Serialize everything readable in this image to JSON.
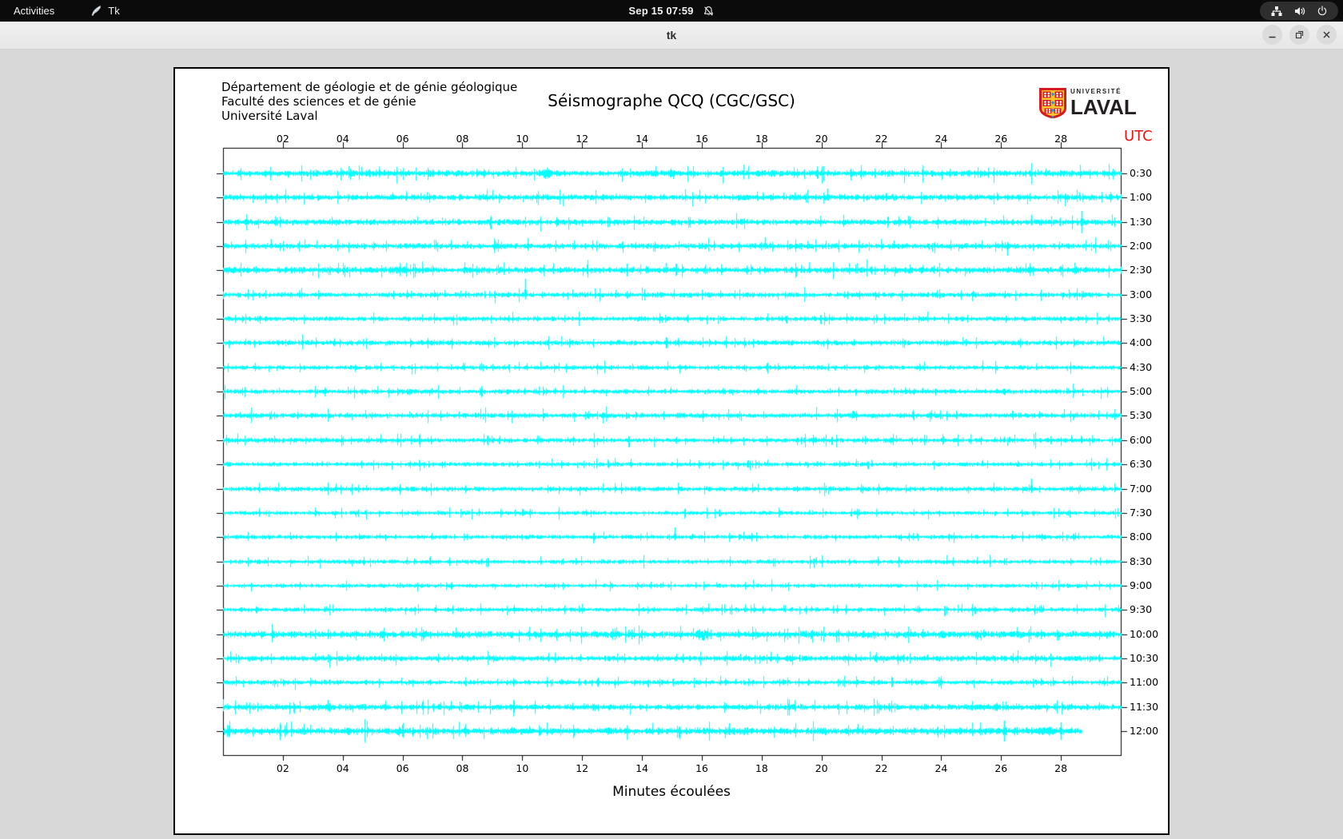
{
  "top_bar": {
    "activities_label": "Activities",
    "app_indicator": "Tk",
    "clock": "Sep 15 07:59"
  },
  "window": {
    "title": "tk"
  },
  "figure": {
    "institution_lines": [
      "Département de géologie et de génie géologique",
      "Faculté des sciences et de génie",
      "Université Laval"
    ],
    "title": "Séismographe QCQ (CGC/GSC)",
    "logo_small": "UNIVERSITÉ",
    "logo_large": "LAVAL",
    "utc_label": "UTC",
    "xlabel": "Minutes écoulées",
    "colors": {
      "trace": "#00ffff",
      "utc_label": "#ee1111",
      "axis": "#000000",
      "logo_red": "#d71920",
      "logo_gold": "#ffc72c",
      "logo_blue": "#1e9cd7"
    }
  },
  "chart_data": {
    "type": "line",
    "title": "Séismographe QCQ (CGC/GSC)",
    "xlabel": "Minutes écoulées",
    "right_axis_title": "UTC",
    "x_range_minutes": [
      0,
      30
    ],
    "x_ticks": [
      "02",
      "04",
      "06",
      "08",
      "10",
      "12",
      "14",
      "16",
      "18",
      "20",
      "22",
      "24",
      "26",
      "28"
    ],
    "x_tick_minutes": [
      2,
      4,
      6,
      8,
      10,
      12,
      14,
      16,
      18,
      20,
      22,
      24,
      26,
      28
    ],
    "trace_color": "#00ffff",
    "rows": [
      {
        "label": "0:30",
        "noise": 1.8,
        "end_minute": 30,
        "events": [
          {
            "type": "burst",
            "m": 10.8,
            "len": 0.5,
            "amp": 7
          },
          {
            "type": "burst",
            "m": 17.9,
            "len": 0.4,
            "amp": 4
          }
        ]
      },
      {
        "label": "1:00",
        "noise": 1.6,
        "end_minute": 30,
        "events": [
          {
            "type": "spike",
            "m": 20.2,
            "up": 11,
            "down": 4
          }
        ]
      },
      {
        "label": "1:30",
        "noise": 1.6,
        "end_minute": 30,
        "events": [
          {
            "type": "spike",
            "m": 22.9,
            "up": 8,
            "down": 3
          },
          {
            "type": "spike",
            "m": 27.0,
            "up": 9,
            "down": 4
          },
          {
            "type": "spike",
            "m": 28.7,
            "up": 14,
            "down": 14
          }
        ]
      },
      {
        "label": "2:00",
        "noise": 1.5,
        "end_minute": 30,
        "events": [
          {
            "type": "spike",
            "m": 1.6,
            "up": 9,
            "down": 3
          },
          {
            "type": "spike",
            "m": 18.1,
            "up": 11,
            "down": 4
          },
          {
            "type": "spike",
            "m": 22.4,
            "up": 7,
            "down": 3
          },
          {
            "type": "spike",
            "m": 26.2,
            "up": 5,
            "down": 12
          }
        ]
      },
      {
        "label": "2:30",
        "noise": 1.7,
        "end_minute": 30,
        "events": [
          {
            "type": "burst",
            "m": 0.2,
            "len": 0.4,
            "amp": 5
          },
          {
            "type": "burst",
            "m": 5.9,
            "len": 0.8,
            "amp": 5
          },
          {
            "type": "spike",
            "m": 13.5,
            "up": 8,
            "down": 8
          },
          {
            "type": "spike",
            "m": 14.8,
            "up": 9,
            "down": 4
          }
        ]
      },
      {
        "label": "3:00",
        "noise": 1.4,
        "end_minute": 30,
        "events": [
          {
            "type": "spike",
            "m": 10.1,
            "up": 20,
            "down": 6
          }
        ]
      },
      {
        "label": "3:30",
        "noise": 1.3,
        "end_minute": 30,
        "events": []
      },
      {
        "label": "4:00",
        "noise": 1.4,
        "end_minute": 30,
        "events": [
          {
            "type": "spike",
            "m": 14.8,
            "up": 7,
            "down": 7
          },
          {
            "type": "spike",
            "m": 15.2,
            "up": 6,
            "down": 3
          }
        ]
      },
      {
        "label": "4:30",
        "noise": 1.2,
        "end_minute": 30,
        "events": []
      },
      {
        "label": "5:00",
        "noise": 1.3,
        "end_minute": 30,
        "events": []
      },
      {
        "label": "5:30",
        "noise": 1.4,
        "end_minute": 30,
        "events": []
      },
      {
        "label": "6:00",
        "noise": 1.3,
        "end_minute": 30,
        "events": []
      },
      {
        "label": "6:30",
        "noise": 1.2,
        "end_minute": 30,
        "events": []
      },
      {
        "label": "7:00",
        "noise": 1.3,
        "end_minute": 30,
        "events": [
          {
            "type": "spike",
            "m": 27.0,
            "up": 13,
            "down": 5
          }
        ]
      },
      {
        "label": "7:30",
        "noise": 1.1,
        "end_minute": 30,
        "events": []
      },
      {
        "label": "8:00",
        "noise": 1.2,
        "end_minute": 30,
        "events": [
          {
            "type": "spike",
            "m": 15.1,
            "up": 12,
            "down": 4
          }
        ]
      },
      {
        "label": "8:30",
        "noise": 1.2,
        "end_minute": 30,
        "events": []
      },
      {
        "label": "9:00",
        "noise": 1.1,
        "end_minute": 30,
        "events": []
      },
      {
        "label": "9:30",
        "noise": 1.2,
        "end_minute": 30,
        "events": []
      },
      {
        "label": "10:00",
        "noise": 1.9,
        "end_minute": 30,
        "events": [
          {
            "type": "burst",
            "m": 16.0,
            "len": 0.6,
            "amp": 8
          },
          {
            "type": "spike",
            "m": 16.3,
            "up": 6,
            "down": 6
          },
          {
            "type": "burst",
            "m": 26.5,
            "len": 0.9,
            "amp": 4
          }
        ]
      },
      {
        "label": "10:30",
        "noise": 1.5,
        "end_minute": 30,
        "events": [
          {
            "type": "burst",
            "m": 18.9,
            "len": 0.5,
            "amp": 5
          }
        ]
      },
      {
        "label": "11:00",
        "noise": 1.3,
        "end_minute": 30,
        "events": []
      },
      {
        "label": "11:30",
        "noise": 1.6,
        "end_minute": 30,
        "events": [
          {
            "type": "spike",
            "m": 3.5,
            "up": 9,
            "down": 5
          },
          {
            "type": "burst",
            "m": 8.2,
            "len": 0.4,
            "amp": 4
          },
          {
            "type": "burst",
            "m": 12.4,
            "len": 0.3,
            "amp": 5
          },
          {
            "type": "burst",
            "m": 25.4,
            "len": 0.6,
            "amp": 4
          }
        ]
      },
      {
        "label": "12:00",
        "noise": 1.9,
        "end_minute": 28.7,
        "events": [
          {
            "type": "spike",
            "m": 1.9,
            "up": 7,
            "down": 10
          },
          {
            "type": "burst",
            "m": 4.2,
            "len": 0.3,
            "amp": 5
          },
          {
            "type": "burst",
            "m": 5.9,
            "len": 0.5,
            "amp": 6
          },
          {
            "type": "burst",
            "m": 11.8,
            "len": 0.4,
            "amp": 5
          },
          {
            "type": "burst",
            "m": 12.9,
            "len": 0.3,
            "amp": 5
          },
          {
            "type": "spike",
            "m": 16.9,
            "up": 10,
            "down": 5
          },
          {
            "type": "spike",
            "m": 21.2,
            "up": 9,
            "down": 4
          },
          {
            "type": "spike",
            "m": 26.1,
            "up": 13,
            "down": 13
          },
          {
            "type": "burst",
            "m": 27.5,
            "len": 1.0,
            "amp": 6
          },
          {
            "type": "spike",
            "m": 28.0,
            "up": 11,
            "down": 11
          }
        ]
      }
    ]
  }
}
